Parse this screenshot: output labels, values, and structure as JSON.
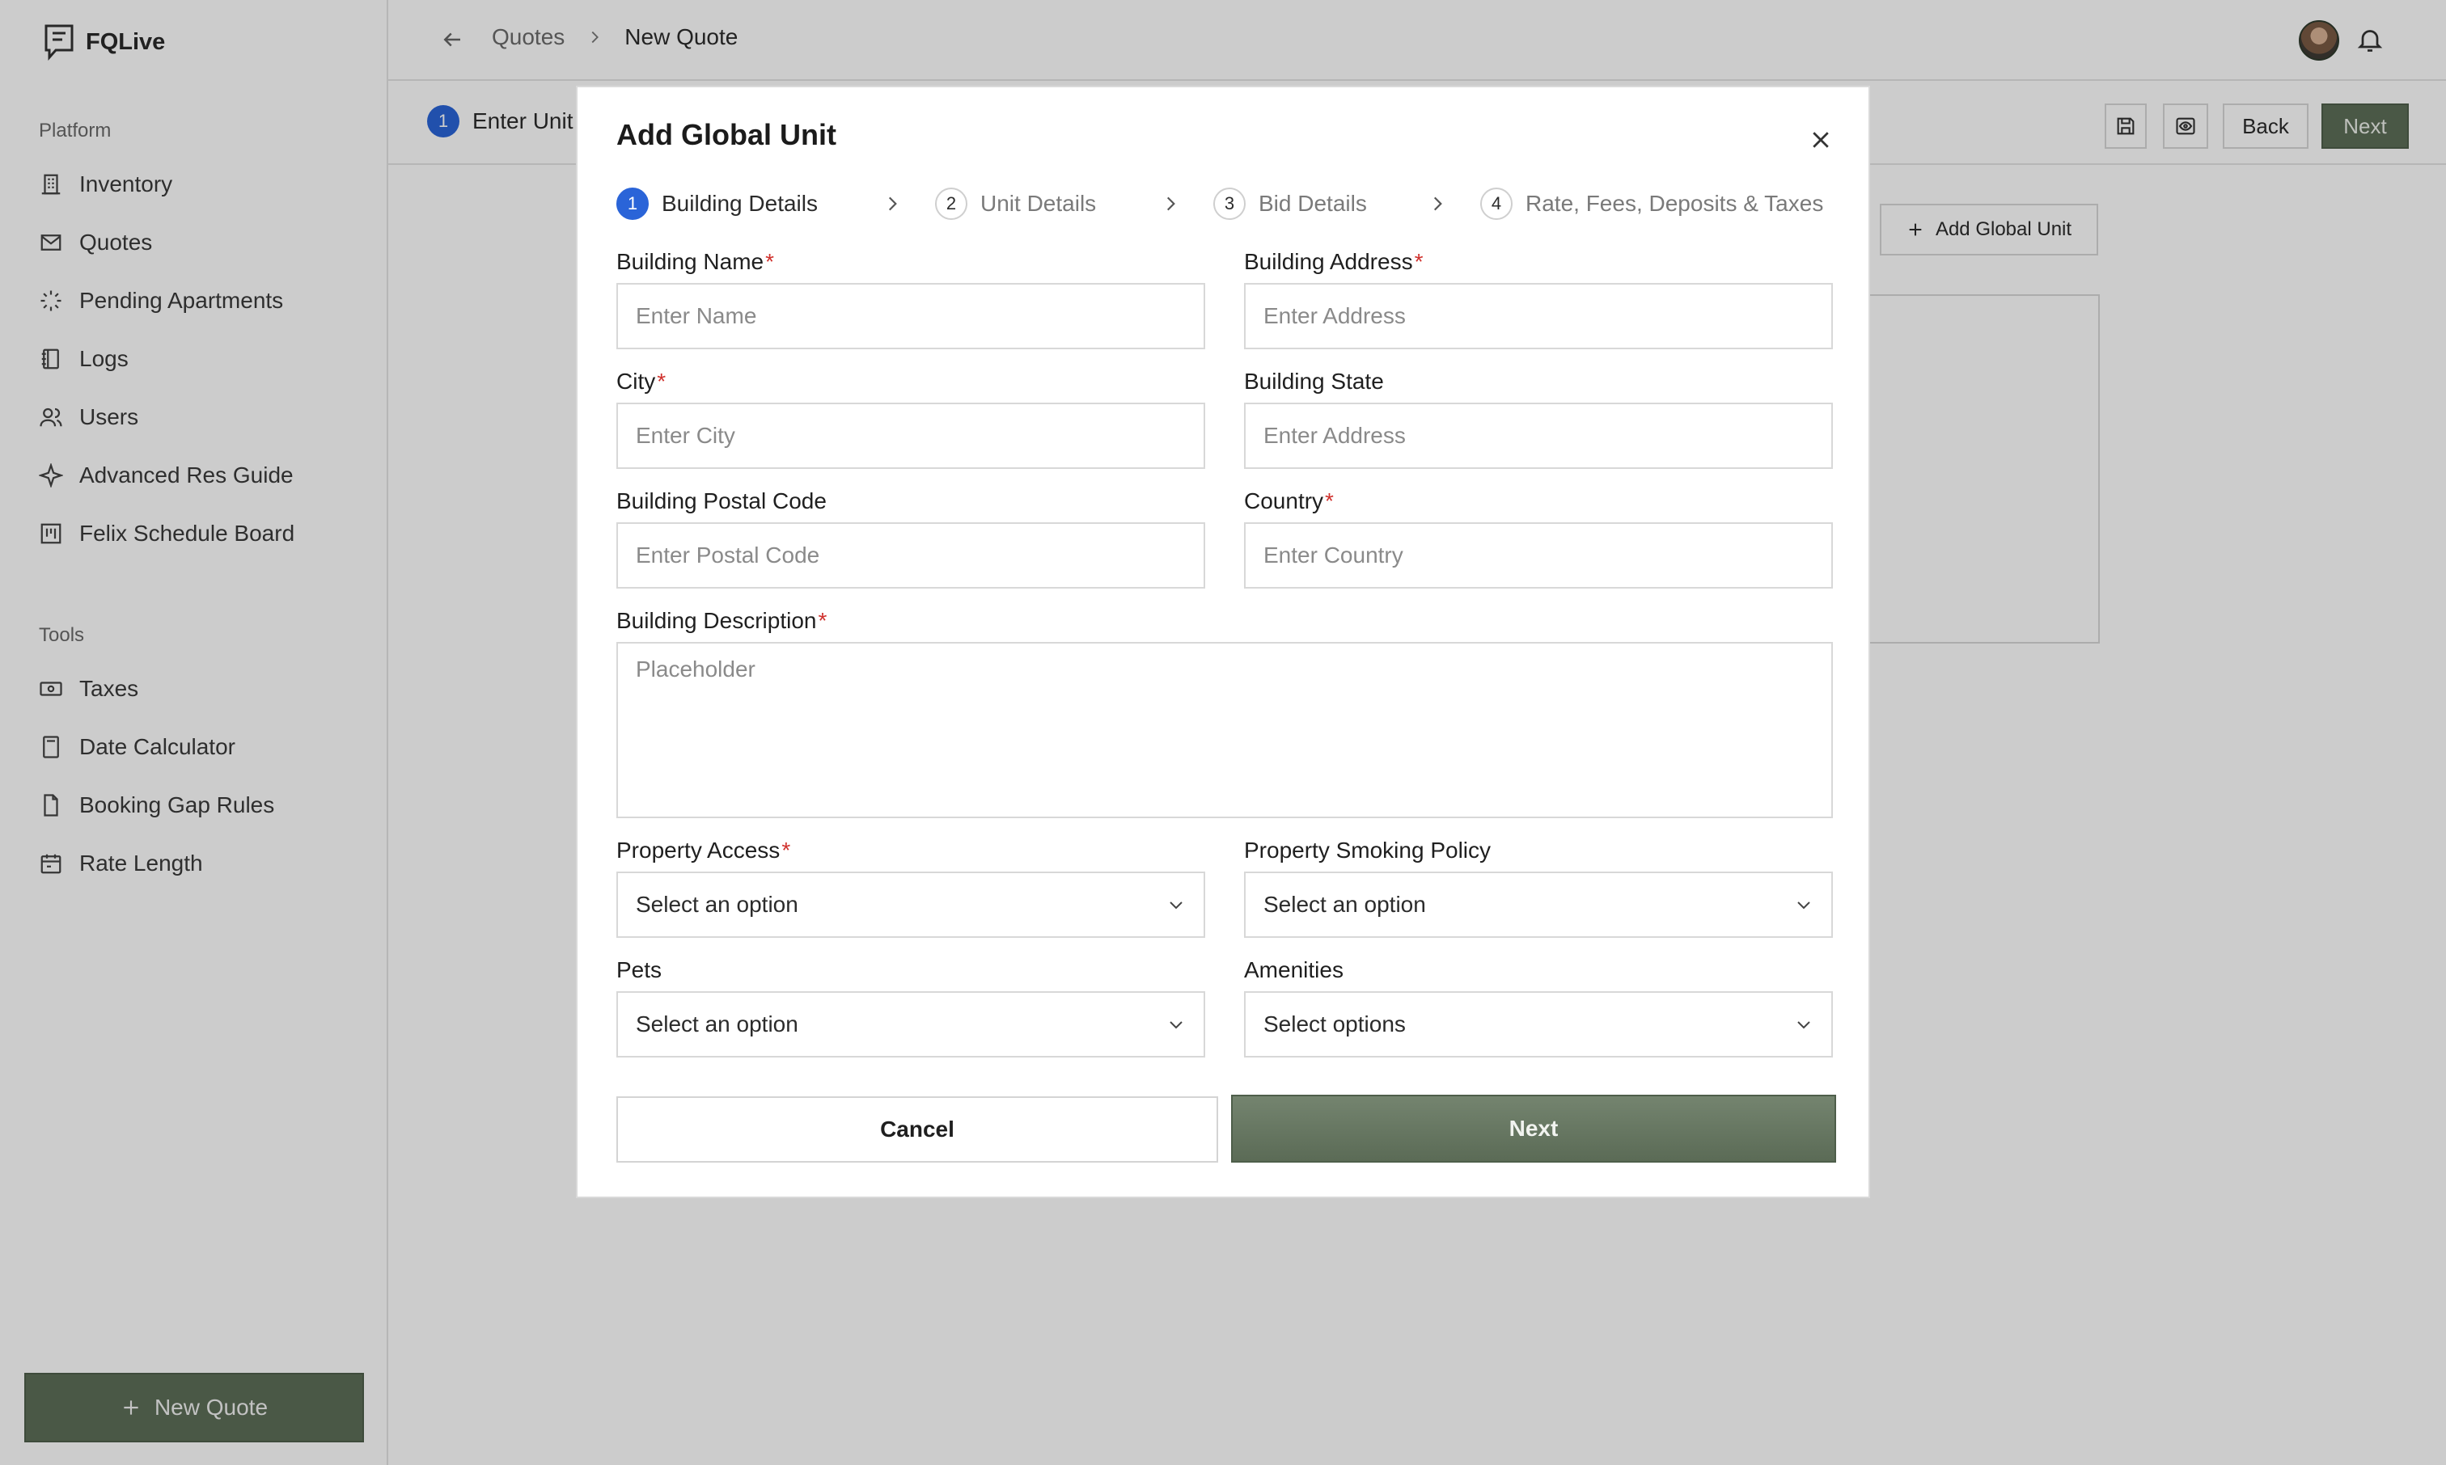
{
  "app": {
    "name": "FQLive"
  },
  "sidebar": {
    "platform_heading": "Platform",
    "platform_items": [
      {
        "label": "Inventory",
        "icon": "building-icon"
      },
      {
        "label": "Quotes",
        "icon": "mail-icon"
      },
      {
        "label": "Pending Apartments",
        "icon": "loader-icon"
      },
      {
        "label": "Logs",
        "icon": "notebook-icon"
      },
      {
        "label": "Users",
        "icon": "users-icon"
      },
      {
        "label": "Advanced Res Guide",
        "icon": "sparkle-icon"
      },
      {
        "label": "Felix Schedule Board",
        "icon": "kanban-icon"
      }
    ],
    "tools_heading": "Tools",
    "tools_items": [
      {
        "label": "Taxes",
        "icon": "banknote-icon"
      },
      {
        "label": "Date Calculator",
        "icon": "calculator-icon"
      },
      {
        "label": "Booking Gap Rules",
        "icon": "file-icon"
      },
      {
        "label": "Rate Length",
        "icon": "calendar-icon"
      }
    ],
    "new_quote_label": "New Quote"
  },
  "topbar": {
    "breadcrumb": [
      "Quotes",
      "New Quote"
    ]
  },
  "page": {
    "step_number": "1",
    "step_label": "Enter Unit",
    "back_label": "Back",
    "next_label": "Next",
    "add_global_unit_label": "Add Global Unit"
  },
  "modal": {
    "title": "Add Global Unit",
    "steps": [
      {
        "num": "1",
        "label": "Building Details",
        "active": true
      },
      {
        "num": "2",
        "label": "Unit Details",
        "active": false
      },
      {
        "num": "3",
        "label": "Bid Details",
        "active": false
      },
      {
        "num": "4",
        "label": "Rate, Fees, Deposits & Taxes",
        "active": false
      }
    ],
    "fields": {
      "building_name": {
        "label": "Building Name",
        "required": "*",
        "placeholder": "Enter Name"
      },
      "building_address": {
        "label": "Building Address",
        "required": "*",
        "placeholder": "Enter Address"
      },
      "city": {
        "label": "City",
        "required": "*",
        "placeholder": "Enter City"
      },
      "building_state": {
        "label": "Building State",
        "placeholder": "Enter Address"
      },
      "postal_code": {
        "label": "Building Postal Code",
        "placeholder": "Enter Postal Code"
      },
      "country": {
        "label": "Country",
        "required": "*",
        "placeholder": "Enter Country"
      },
      "description": {
        "label": "Building Description",
        "required": "*",
        "placeholder": "Placeholder"
      },
      "property_access": {
        "label": "Property Access",
        "required": "*",
        "value": "Select an option"
      },
      "smoking_policy": {
        "label": "Property Smoking Policy",
        "value": "Select an option"
      },
      "pets": {
        "label": "Pets",
        "value": "Select an option"
      },
      "amenities": {
        "label": "Amenities",
        "value": "Select options"
      }
    },
    "cancel_label": "Cancel",
    "next_label": "Next"
  },
  "colors": {
    "accent_green": "#5d6e58",
    "step_blue": "#2a64d8",
    "required_red": "#d0312d"
  }
}
